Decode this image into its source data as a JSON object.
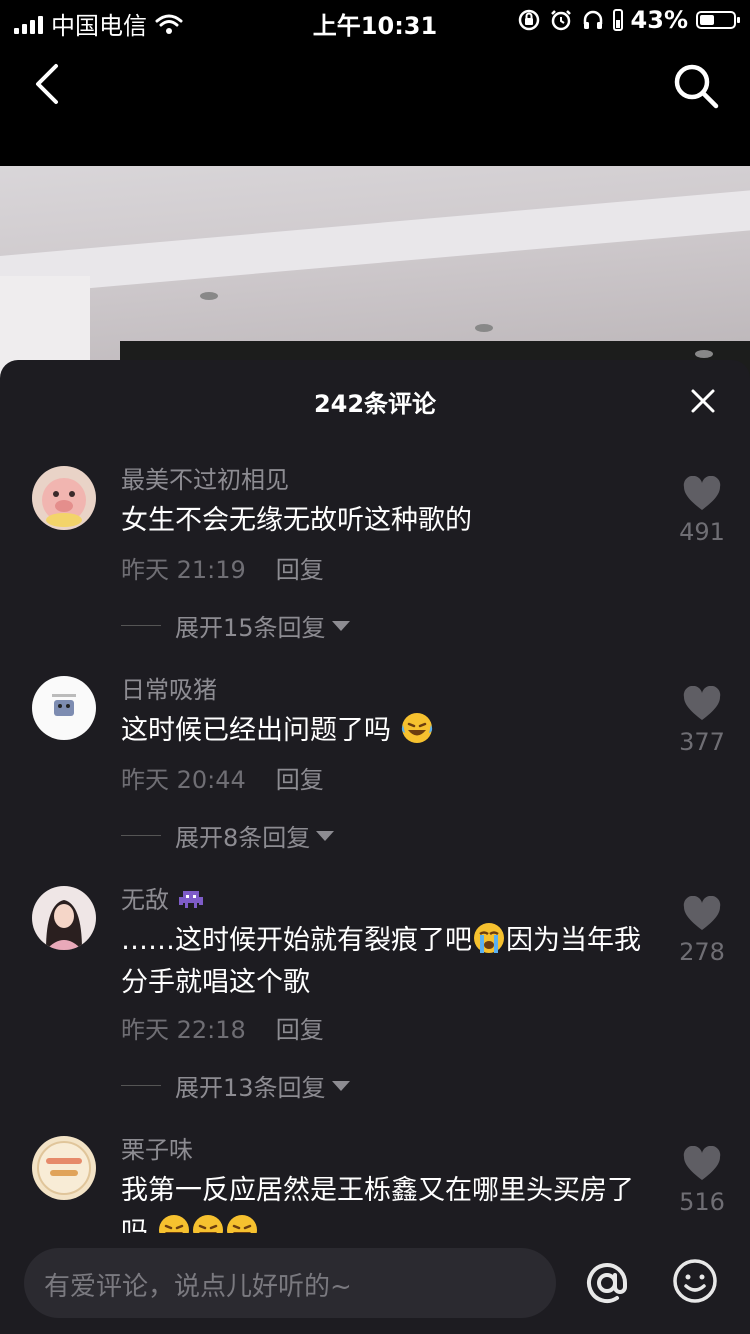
{
  "status_bar": {
    "carrier": "中国电信",
    "time": "上午10:31",
    "battery_percent": "43%",
    "battery_level": 0.43
  },
  "sheet": {
    "title": "242条评论"
  },
  "comments": [
    {
      "username": "最美不过初相见",
      "text": "女生不会无缘无故听这种歌的",
      "time": "昨天 21:19",
      "reply_label": "回复",
      "expand_label": "展开15条回复",
      "likes": "491"
    },
    {
      "username": "日常吸猪",
      "text": "这时候已经出问题了吗",
      "text_emoji": "laughing-crying-emoji",
      "time": "昨天 20:44",
      "reply_label": "回复",
      "expand_label": "展开8条回复",
      "likes": "377"
    },
    {
      "username": "无敌",
      "username_emoji": "alien-monster-emoji",
      "text_part1": "……这时候开始就有裂痕了吧",
      "text_emoji": "loudly-crying-emoji",
      "text_part2": "因为当年我分手就唱这个歌",
      "time": "昨天 22:18",
      "reply_label": "回复",
      "expand_label": "展开13条回复",
      "likes": "278"
    },
    {
      "username": "栗子味",
      "text": "我第一反应居然是王栎鑫又在哪里头买房了吗",
      "text_emoji": "laughing-crying-emoji",
      "likes": "516"
    }
  ],
  "input": {
    "placeholder": "有爱评论，说点儿好听的~"
  },
  "colors": {
    "sheet_bg": "#1d1c21",
    "username": "#8d8c92",
    "meta": "#6f6e74",
    "like_heart": "#5f5e64"
  }
}
